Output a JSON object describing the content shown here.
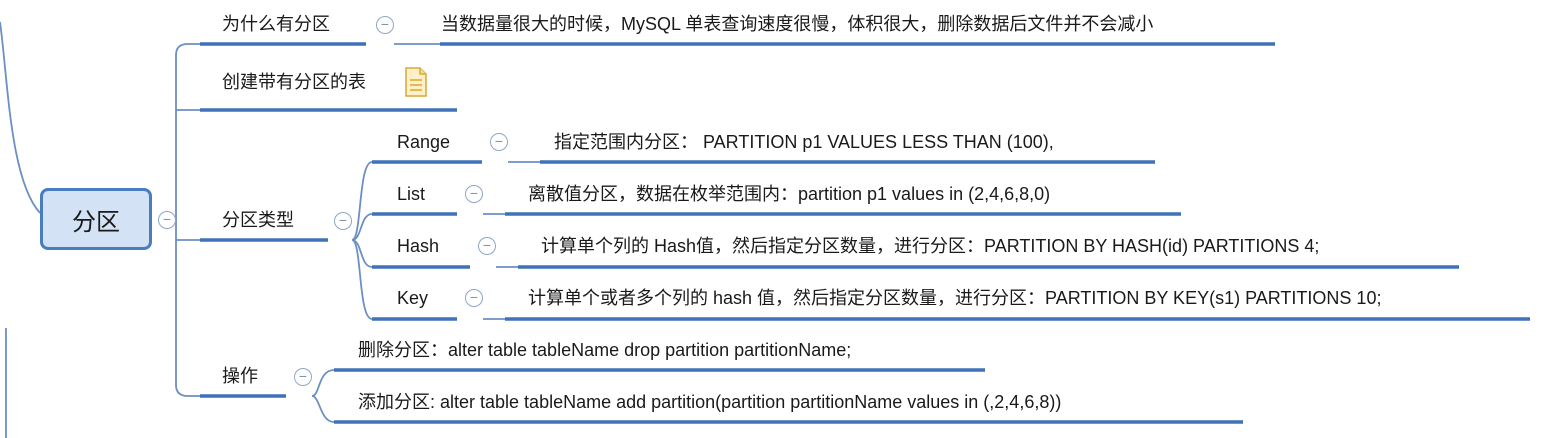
{
  "root": {
    "label": "分区"
  },
  "branches": {
    "why": {
      "label": "为什么有分区",
      "note": "当数据量很大的时候，MySQL 单表查询速度很慢，体积很大，删除数据后文件并不会减小"
    },
    "create": {
      "label": "创建带有分区的表",
      "icon": "document-icon"
    },
    "types": {
      "label": "分区类型",
      "items": [
        {
          "label": "Range",
          "note": "指定范围内分区： PARTITION p1 VALUES LESS THAN (100),"
        },
        {
          "label": "List",
          "note": "离散值分区，数据在枚举范围内：partition p1 values in (2,4,6,8,0)"
        },
        {
          "label": "Hash",
          "note": "计算单个列的 Hash值，然后指定分区数量，进行分区：PARTITION BY HASH(id) PARTITIONS 4;"
        },
        {
          "label": "Key",
          "note": "计算单个或者多个列的 hash 值，然后指定分区数量，进行分区：PARTITION BY KEY(s1) PARTITIONS 10;"
        }
      ]
    },
    "ops": {
      "label": "操作",
      "items": [
        "删除分区：alter table tableName  drop partition partitionName;",
        "添加分区: alter table tableName add partition(partition partitionName values in (,2,4,6,8))"
      ]
    }
  },
  "toggle_symbol": "−",
  "colors": {
    "connector": "#6c8fc4",
    "underline": "#3f72b8",
    "root_fill": "#d4e2f5",
    "root_border": "#4a7cc0"
  }
}
